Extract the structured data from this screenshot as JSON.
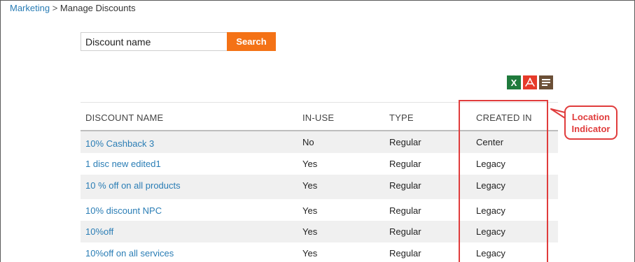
{
  "breadcrumb": {
    "parent": "Marketing",
    "separator": ">",
    "current": "Manage Discounts"
  },
  "search": {
    "placeholder": "Discount name",
    "button_label": "Search"
  },
  "export": {
    "excel_glyph": "X",
    "excel_icon": "excel-icon",
    "pdf_icon": "pdf-icon",
    "csv_icon": "text-report-icon"
  },
  "table": {
    "columns": [
      "DISCOUNT NAME",
      "IN-USE",
      "TYPE",
      "CREATED IN"
    ],
    "rows": [
      {
        "name": "10% Cashback 3",
        "in_use": "No",
        "type": "Regular",
        "created_in": "Center"
      },
      {
        "name": "1 disc new edited1",
        "in_use": "Yes",
        "type": "Regular",
        "created_in": "Legacy"
      },
      {
        "name": "10 % off on all products",
        "in_use": "Yes",
        "type": "Regular",
        "created_in": "Legacy"
      },
      {
        "name": "10% discount NPC",
        "in_use": "Yes",
        "type": "Regular",
        "created_in": "Legacy"
      },
      {
        "name": "10%off",
        "in_use": "Yes",
        "type": "Regular",
        "created_in": "Legacy"
      },
      {
        "name": "10%off on all services",
        "in_use": "Yes",
        "type": "Regular",
        "created_in": "Legacy"
      }
    ]
  },
  "annotation": {
    "line1": "Location",
    "line2": "Indicator"
  },
  "colors": {
    "accent": "#f47216",
    "link": "#2a7db5",
    "annotation": "#e03c3c"
  }
}
